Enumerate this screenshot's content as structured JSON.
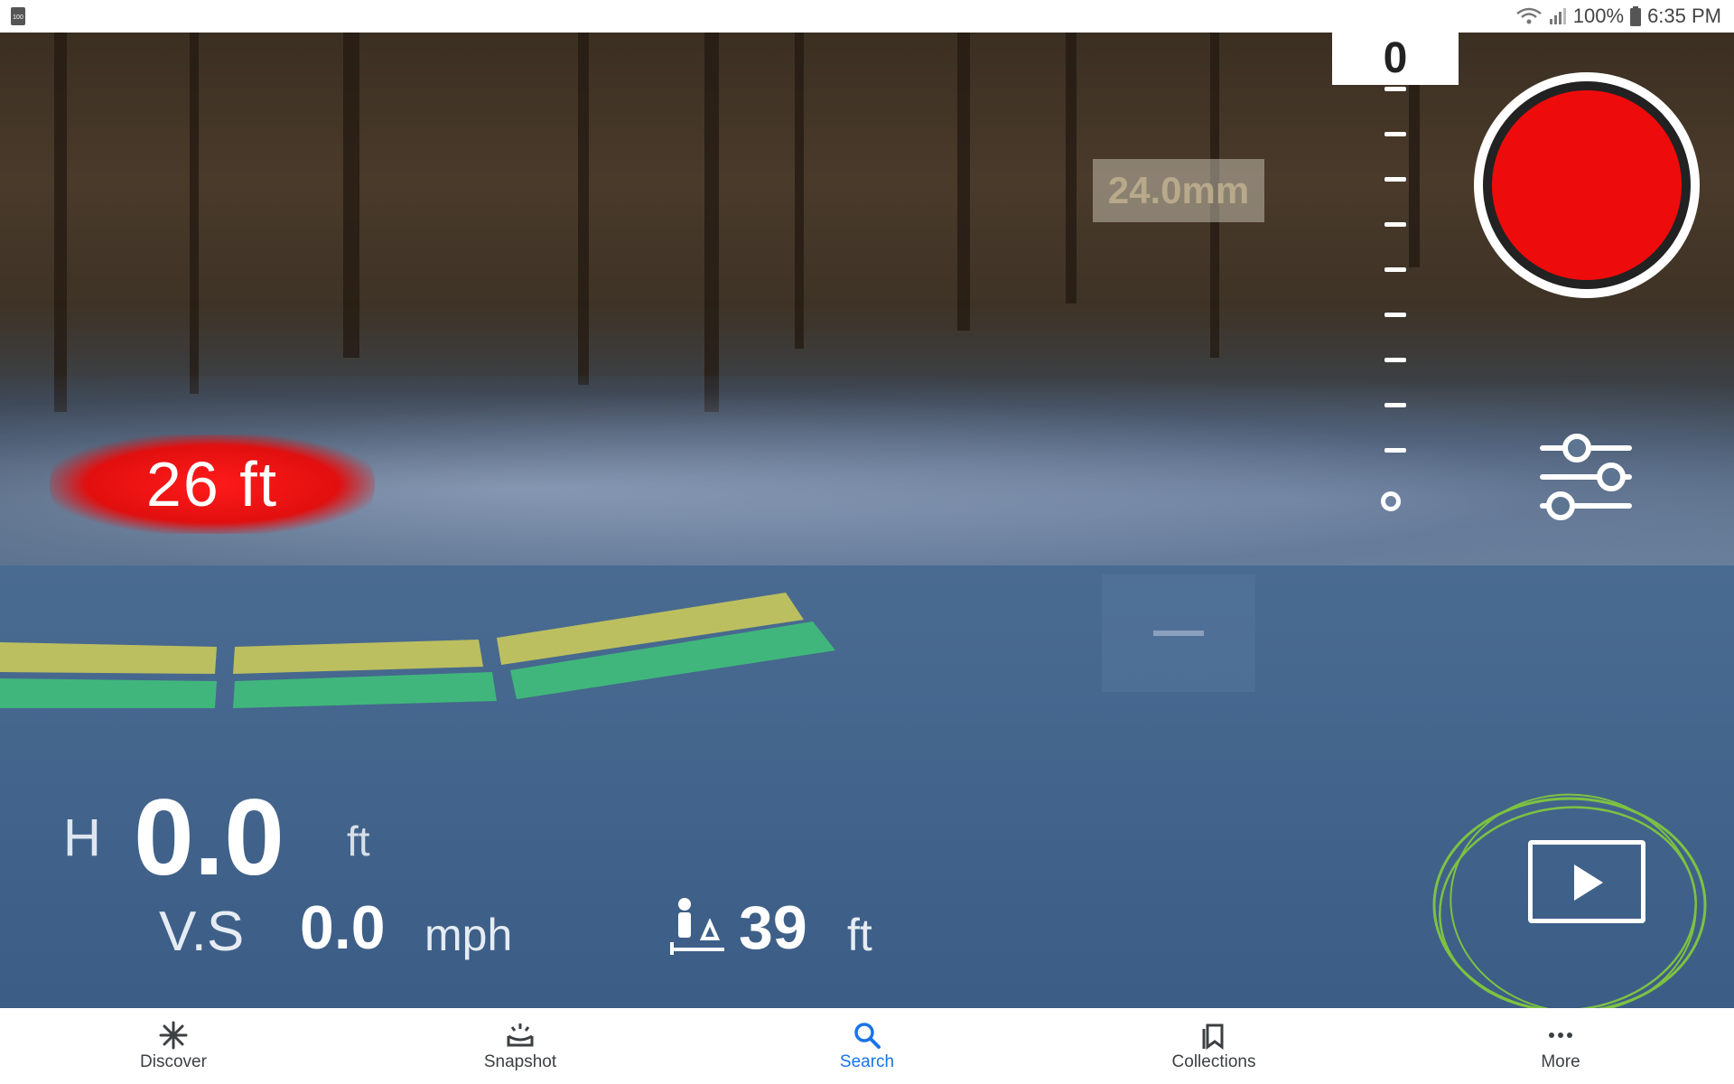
{
  "status_bar": {
    "battery_percent": "100%",
    "time": "6:35 PM"
  },
  "hud": {
    "focal_length": "24.0mm",
    "altitude_scale_value": "0",
    "obstacle_distance": "26 ft",
    "height_label": "H",
    "height_value": "0.0",
    "height_unit": "ft",
    "vs_label": "V.S",
    "vs_value": "0.0",
    "vs_unit": "mph",
    "distance_value": "39",
    "distance_unit": "ft",
    "record_color": "#ee0b0b",
    "annotation_color": "#7dc242"
  },
  "bottom_nav": {
    "items": [
      {
        "label": "Discover",
        "icon": "asterisk-icon"
      },
      {
        "label": "Snapshot",
        "icon": "snapshot-icon"
      },
      {
        "label": "Search",
        "icon": "search-icon",
        "active": true
      },
      {
        "label": "Collections",
        "icon": "collections-icon"
      },
      {
        "label": "More",
        "icon": "more-icon"
      }
    ]
  }
}
